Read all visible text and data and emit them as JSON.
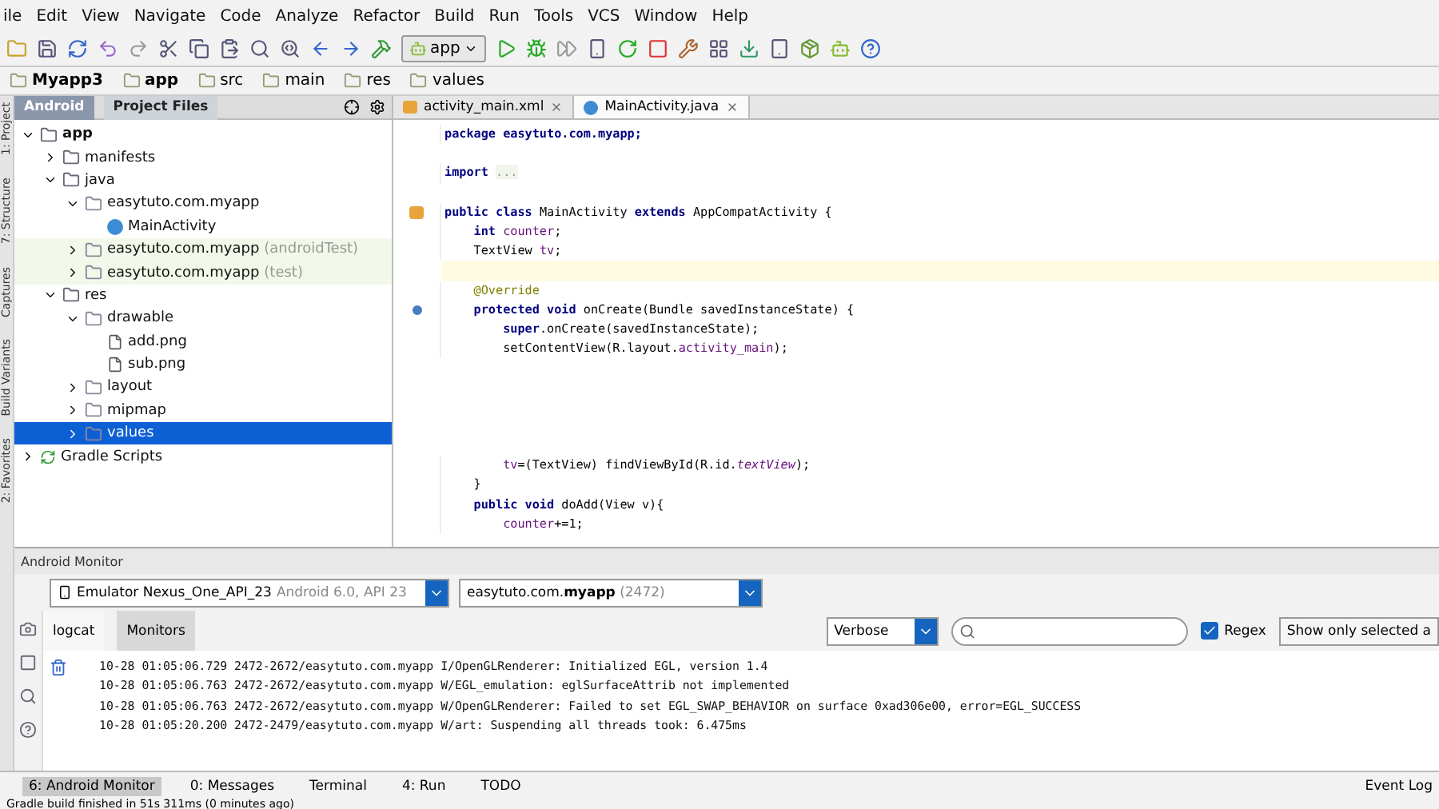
{
  "menu": [
    "ile",
    "Edit",
    "View",
    "Navigate",
    "Code",
    "Analyze",
    "Refactor",
    "Build",
    "Run",
    "Tools",
    "VCS",
    "Window",
    "Help"
  ],
  "toolbar": {
    "run_config": "app"
  },
  "breadcrumbs": [
    "Myapp3",
    "app",
    "src",
    "main",
    "res",
    "values"
  ],
  "side_strip": [
    "1: Project",
    "7: Structure",
    "Captures",
    "Build Variants",
    "2: Favorites"
  ],
  "project_tabs": [
    {
      "label": "Android",
      "selected": true
    },
    {
      "label": "Project Files",
      "selected": false
    }
  ],
  "tree": [
    {
      "label": "app",
      "kind": "module",
      "expanded": true,
      "selected": false,
      "children": [
        {
          "label": "manifests",
          "kind": "folder",
          "expanded": false,
          "selected": false
        },
        {
          "label": "java",
          "kind": "folder",
          "expanded": true,
          "selected": false,
          "children": [
            {
              "label": "easytuto.com.myapp",
              "kind": "package",
              "expanded": true,
              "selected": false,
              "children": [
                {
                  "label": "MainActivity",
                  "kind": "class",
                  "selected": false
                }
              ]
            },
            {
              "label": "easytuto.com.myapp",
              "suffix": "(androidTest)",
              "kind": "package",
              "expanded": false,
              "selected": false,
              "tinted": true
            },
            {
              "label": "easytuto.com.myapp",
              "suffix": "(test)",
              "kind": "package",
              "expanded": false,
              "selected": false,
              "tinted": true
            }
          ]
        },
        {
          "label": "res",
          "kind": "folder",
          "expanded": true,
          "selected": false,
          "children": [
            {
              "label": "drawable",
              "kind": "package",
              "expanded": true,
              "selected": false,
              "children": [
                {
                  "label": "add.png",
                  "kind": "file",
                  "selected": false
                },
                {
                  "label": "sub.png",
                  "kind": "file",
                  "selected": false
                }
              ]
            },
            {
              "label": "layout",
              "kind": "package",
              "expanded": false,
              "selected": false
            },
            {
              "label": "mipmap",
              "kind": "package",
              "expanded": false,
              "selected": false
            },
            {
              "label": "values",
              "kind": "package",
              "expanded": false,
              "selected": true
            }
          ]
        }
      ]
    },
    {
      "label": "Gradle Scripts",
      "kind": "gradle",
      "expanded": false,
      "selected": false
    }
  ],
  "editor_tabs": [
    {
      "label": "activity_main.xml",
      "kind": "xml",
      "selected": false
    },
    {
      "label": "MainActivity.java",
      "kind": "java",
      "selected": true
    }
  ],
  "code": [
    {
      "parts": [
        {
          "text": "package easytuto.com.myapp;",
          "kind": "kw"
        }
      ]
    },
    {
      "kind": "blank"
    },
    {
      "kind": "code",
      "parts": [
        {
          "text": "import ",
          "kind": "kw"
        },
        {
          "text": "...",
          "kind": "fold"
        }
      ]
    },
    {
      "kind": "blank"
    },
    {
      "kind": "activity_marker",
      "parts": [
        {
          "text": "public class ",
          "kind": "kw"
        },
        {
          "text": "MainActivity ",
          "kind": "plain"
        },
        {
          "text": "extends ",
          "kind": "kw"
        },
        {
          "text": "AppCompatActivity {",
          "kind": "plain"
        }
      ]
    },
    {
      "parts": [
        {
          "text": "    int ",
          "kind": "kw"
        },
        {
          "text": "counter",
          "kind": "field"
        },
        {
          "text": ";",
          "kind": "plain"
        }
      ]
    },
    {
      "parts": [
        {
          "text": "    TextView ",
          "kind": "plain"
        },
        {
          "text": "tv",
          "kind": "field"
        },
        {
          "text": ";",
          "kind": "plain"
        }
      ]
    },
    {
      "kind": "caret"
    },
    {
      "kind": "code",
      "parts": [
        {
          "text": "    @Override",
          "kind": "annotation"
        }
      ]
    },
    {
      "kind": "override_marker",
      "parts": [
        {
          "text": "    protected void ",
          "kind": "kw"
        },
        {
          "text": "onCreate(Bundle savedInstanceState) {",
          "kind": "plain"
        }
      ]
    },
    {
      "parts": [
        {
          "text": "        super",
          "kind": "kw"
        },
        {
          "text": ".onCreate(savedInstanceState);",
          "kind": "plain"
        }
      ]
    },
    {
      "parts": [
        {
          "text": "        setContentView(R.layout.",
          "kind": "plain"
        },
        {
          "text": "activity_main",
          "kind": "field"
        },
        {
          "text": ");",
          "kind": "plain"
        }
      ]
    },
    {
      "kind": "blank"
    },
    {
      "kind": "blank"
    },
    {
      "kind": "blank"
    },
    {
      "kind": "blank"
    },
    {
      "kind": "blank"
    },
    {
      "kind": "code",
      "parts": [
        {
          "text": "        tv",
          "kind": "field"
        },
        {
          "text": "=(TextView) findViewById(R.id.",
          "kind": "plain"
        },
        {
          "text": "textView",
          "kind": "italic"
        },
        {
          "text": ");",
          "kind": "plain"
        }
      ]
    },
    {
      "parts": [
        {
          "text": "    }",
          "kind": "plain"
        }
      ]
    },
    {
      "parts": [
        {
          "text": "    public void ",
          "kind": "kw"
        },
        {
          "text": "doAdd(View v){",
          "kind": "plain"
        }
      ]
    },
    {
      "parts": [
        {
          "text": "        counter",
          "kind": "field"
        },
        {
          "text": "+=1;",
          "kind": "plain"
        }
      ]
    }
  ],
  "monitor": {
    "title": "Android Monitor",
    "device": "Emulator Nexus_One_API_23",
    "device_detail": "Android 6.0, API 23",
    "process": "easytuto.com.",
    "process_bold": "myapp",
    "process_pid": "(2472)",
    "tabs": [
      {
        "label": "logcat",
        "selected": true
      },
      {
        "label": "Monitors",
        "selected": false
      }
    ],
    "level": "Verbose",
    "regex": {
      "label": "Regex",
      "checked": true
    },
    "filter": "Show only selected a",
    "log": [
      "10-28 01:05:06.729 2472-2672/easytuto.com.myapp I/OpenGLRenderer: Initialized EGL, version 1.4",
      "10-28 01:05:06.763 2472-2672/easytuto.com.myapp W/EGL_emulation: eglSurfaceAttrib not implemented",
      "10-28 01:05:06.763 2472-2672/easytuto.com.myapp W/OpenGLRenderer: Failed to set EGL_SWAP_BEHAVIOR on surface 0xad306e00, error=EGL_SUCCESS",
      "10-28 01:05:20.200 2472-2479/easytuto.com.myapp W/art: Suspending all threads took: 6.475ms"
    ]
  },
  "tool_windows": [
    {
      "label": "6: Android Monitor",
      "selected": true
    },
    {
      "label": "0: Messages",
      "selected": false
    },
    {
      "label": "Terminal",
      "selected": false
    },
    {
      "label": "4: Run",
      "selected": false
    },
    {
      "label": "TODO",
      "selected": false
    }
  ],
  "event_log": "Event Log",
  "status": "Gradle build finished in 51s 311ms (0 minutes ago)"
}
